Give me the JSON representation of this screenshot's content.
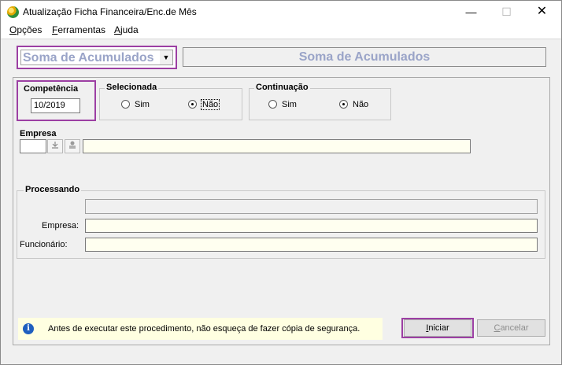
{
  "window": {
    "title": "Atualização Ficha Financeira/Enc.de Mês",
    "min_glyph": "—",
    "max_glyph": "☐",
    "close_glyph": "✕"
  },
  "menu": {
    "items": [
      {
        "first": "O",
        "rest": "pções"
      },
      {
        "first": "F",
        "rest": "erramentas"
      },
      {
        "first": "A",
        "rest": "juda"
      }
    ]
  },
  "header": {
    "combo_value": "Soma de Acumulados",
    "combo_arrow": "▼",
    "title": "Soma de Acumulados"
  },
  "competencia": {
    "label": "Competência",
    "value": "10/2019"
  },
  "selecionada": {
    "label": "Selecionada",
    "options": [
      "Sim",
      "Não"
    ],
    "selected": "Não"
  },
  "continuacao": {
    "label": "Continuação",
    "options": [
      "Sim",
      "Não"
    ],
    "selected": "Não"
  },
  "empresa": {
    "label": "Empresa",
    "code": "",
    "name": ""
  },
  "processando": {
    "label": "Processando",
    "empresa_label": "Empresa:",
    "funcionario_label": "Funcionário:",
    "empresa_value": "",
    "funcionario_value": ""
  },
  "info": {
    "glyph": "i",
    "message": "Antes de executar este procedimento, não esqueça de fazer cópia de segurança."
  },
  "buttons": {
    "iniciar_first": "I",
    "iniciar_rest": "niciar",
    "cancelar_first": "C",
    "cancelar_rest": "ancelar"
  },
  "icons": {
    "app": "app-icon",
    "down": "download-icon",
    "search": "search-person-icon"
  }
}
